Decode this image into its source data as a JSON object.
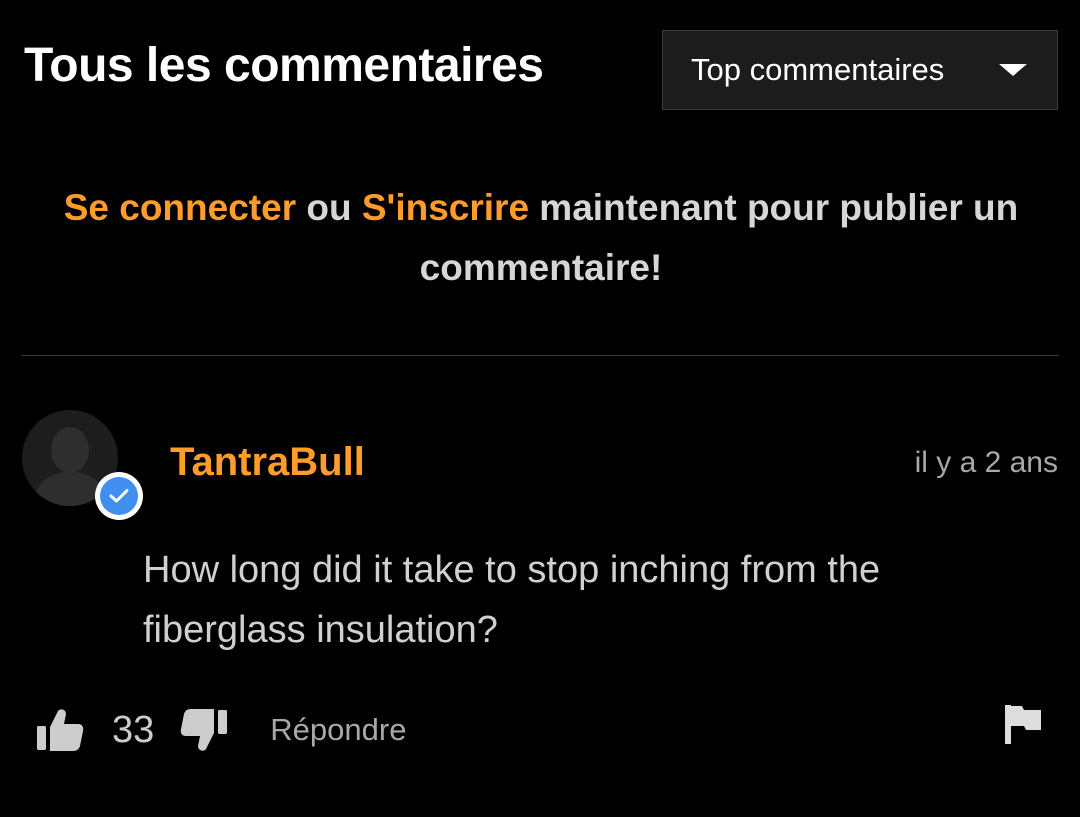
{
  "header": {
    "title": "Tous les commentaires",
    "sort": {
      "selected": "Top commentaires",
      "icon": "caret-down-icon"
    }
  },
  "login_prompt": {
    "login_link": "Se connecter",
    "or": " ou ",
    "signup_link": "S'inscrire",
    "rest": " maintenant pour publier un commentaire!"
  },
  "comment": {
    "username": "TantraBull",
    "verified": true,
    "time": "il y a 2 ans",
    "text": "How long did it take to stop inching from the fiberglass insulation?",
    "likes": "33",
    "reply_label": "Répondre"
  },
  "icons": {
    "like": "thumbs-up-icon",
    "dislike": "thumbs-down-icon",
    "flag": "flag-icon",
    "verified": "check-badge-icon"
  },
  "colors": {
    "background": "#000000",
    "accent": "#ff9c2a",
    "badge": "#3f8ef0"
  }
}
